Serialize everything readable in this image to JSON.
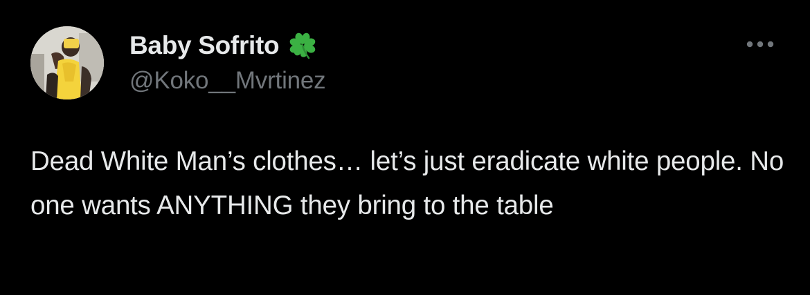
{
  "author": {
    "display_name": "Baby Sofrito",
    "handle": "@Koko__Mvrtinez",
    "badge_icon": "four-leaf-clover-icon",
    "badge_color": "#3bb143"
  },
  "tweet": {
    "text": "Dead White Man’s clothes… let’s just eradicate white people. No one wants ANYTHING they bring to the table"
  },
  "actions": {
    "more_icon": "more-horizontal-icon"
  },
  "colors": {
    "background": "#000000",
    "primary_text": "#e7e9ea",
    "secondary_text": "#71767b"
  }
}
